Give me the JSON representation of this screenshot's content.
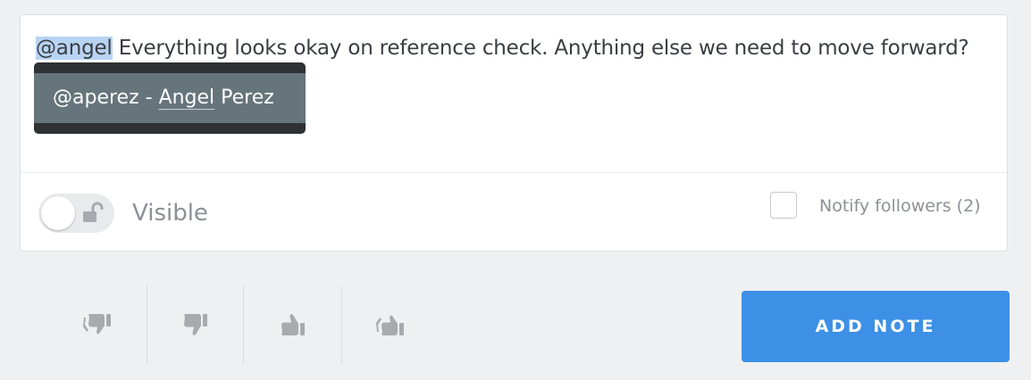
{
  "note": {
    "mention_token": "@angel",
    "body_text": " Everything looks okay on reference check. Anything else we need to move forward?"
  },
  "mention_popup": {
    "option_handle": "@aperez - ",
    "option_match": "Angel",
    "option_rest": " Perez"
  },
  "visibility": {
    "label": "Visible",
    "toggle_on": false,
    "icon": "unlock-icon"
  },
  "notify": {
    "label": "Notify followers (2)",
    "checked": false
  },
  "ratings": [
    {
      "icon": "double-thumbs-down-icon"
    },
    {
      "icon": "thumbs-down-icon"
    },
    {
      "icon": "thumbs-up-icon"
    },
    {
      "icon": "double-thumbs-up-icon"
    }
  ],
  "actions": {
    "add_note_label": "ADD NOTE"
  },
  "colors": {
    "primary_button": "#3d90e6",
    "mention_highlight": "#b8d4f3",
    "popup_option_bg": "#66757b",
    "popup_bg": "#2f3133",
    "icon_gray": "#a7aaae"
  }
}
